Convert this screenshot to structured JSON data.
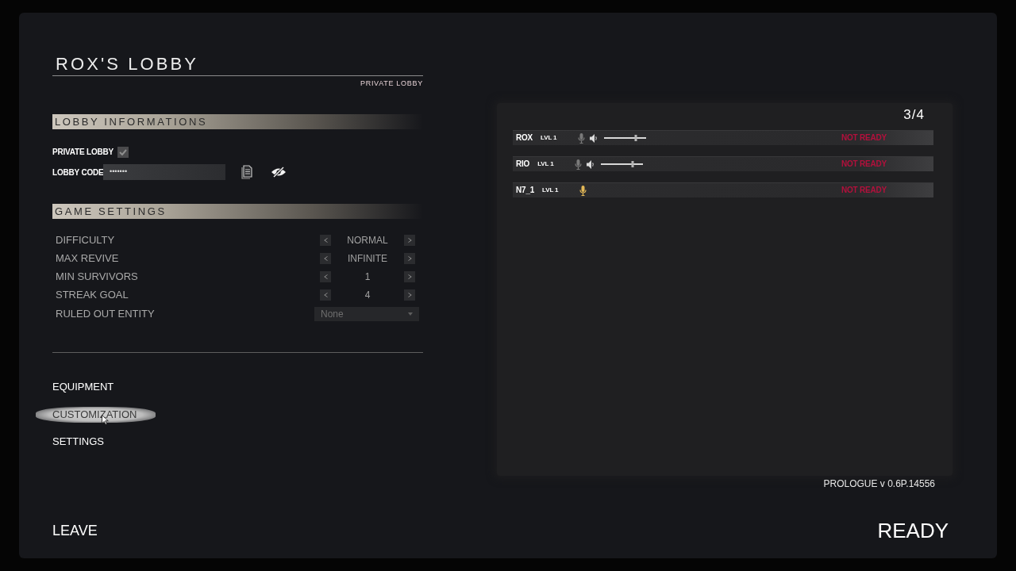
{
  "lobby": {
    "title": "ROX'S LOBBY",
    "privacy": "PRIVATE LOBBY"
  },
  "lobby_info": {
    "heading": "LOBBY INFORMATIONS",
    "private_lobby": {
      "label": "PRIVATE LOBBY",
      "checked": true
    },
    "lobby_code": {
      "label": "LOBBY CODE",
      "value": "•••••••"
    }
  },
  "game_settings": {
    "heading": "GAME SETTINGS",
    "rows": [
      {
        "kind": "stepper",
        "label": "DIFFICULTY",
        "value": "NORMAL"
      },
      {
        "kind": "stepper",
        "label": "MAX REVIVE",
        "value": "INFINITE"
      },
      {
        "kind": "stepper",
        "label": "MIN SURVIVORS",
        "value": "1"
      },
      {
        "kind": "stepper",
        "label": "STREAK GOAL",
        "value": "4"
      },
      {
        "kind": "dropdown",
        "label": "RULED OUT ENTITY",
        "value": "None"
      }
    ]
  },
  "menu": [
    {
      "label": "EQUIPMENT",
      "selected": false
    },
    {
      "label": "CUSTOMIZATION",
      "selected": true
    },
    {
      "label": "SETTINGS",
      "selected": false
    }
  ],
  "leave": {
    "label": "LEAVE"
  },
  "players": {
    "count": "3/4",
    "rows": [
      {
        "kind": "remote",
        "name": "ROX",
        "rank": "LVL 1",
        "talking": false,
        "level": 0.74,
        "status": "NOT READY"
      },
      {
        "kind": "remote",
        "name": "RIO",
        "rank": "LVL 1",
        "talking": false,
        "level": 0.74,
        "status": "NOT READY"
      },
      {
        "kind": "local",
        "name": "N7_1",
        "rank": "LVL 1",
        "talking": true,
        "status": "NOT READY"
      }
    ]
  },
  "version": "PROLOGUE v 0.6P.14556",
  "ready": {
    "label": "READY"
  }
}
